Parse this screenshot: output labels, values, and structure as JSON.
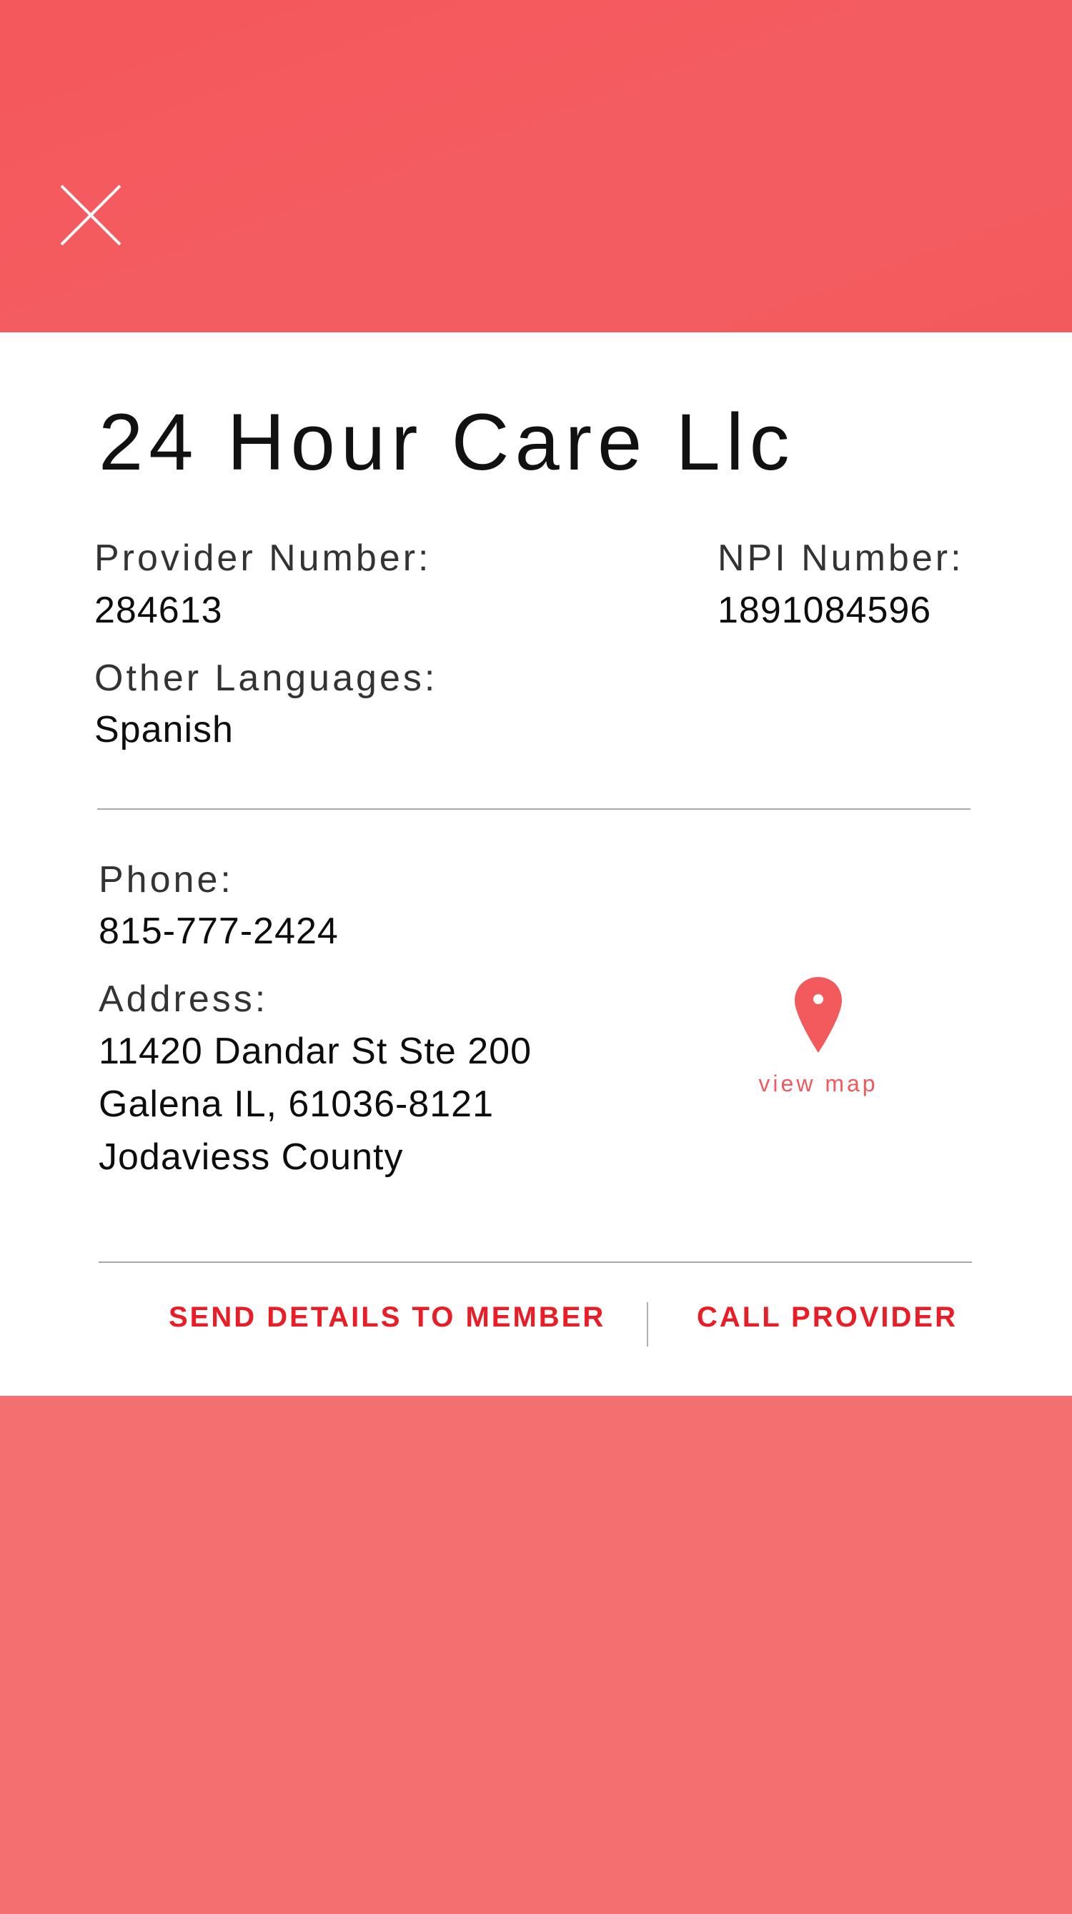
{
  "header": {
    "close_icon": "close-icon",
    "background_color": "#f3585c"
  },
  "provider": {
    "name": "24 Hour Care Llc",
    "provider_number_label": "Provider Number:",
    "provider_number": "284613",
    "npi_label": "NPI Number:",
    "npi": "1891084596",
    "languages_label": "Other Languages:",
    "languages": "Spanish"
  },
  "contact": {
    "phone_label": "Phone:",
    "phone": "815-777-2424",
    "address_label": "Address:",
    "address_line1": "11420 Dandar St Ste 200",
    "address_line2": "Galena IL, 61036-8121",
    "address_line3": "Jodaviess County",
    "map_icon": "map-pin-icon",
    "view_map_label": "view map"
  },
  "actions": {
    "send_details_label": "SEND DETAILS TO MEMBER",
    "call_provider_label": "CALL PROVIDER",
    "accent_color": "#ea1c26"
  }
}
